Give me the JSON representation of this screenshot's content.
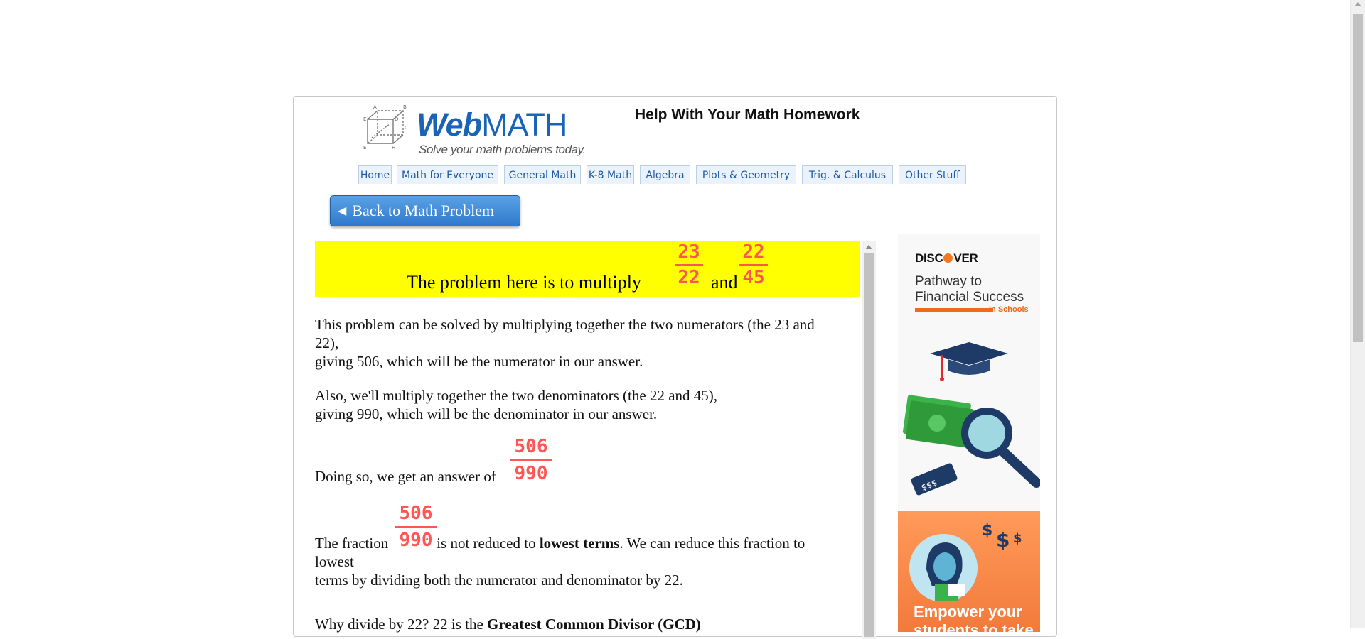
{
  "header": {
    "brand_web": "Web",
    "brand_math": "MATH",
    "tagline": "Solve your math problems today.",
    "title": "Help With Your Math Homework"
  },
  "nav": {
    "tabs": [
      {
        "label": "Home"
      },
      {
        "label": "Math for Everyone"
      },
      {
        "label": "General Math"
      },
      {
        "label": "K-8 Math"
      },
      {
        "label": "Algebra"
      },
      {
        "label": "Plots & Geometry"
      },
      {
        "label": "Trig. & Calculus"
      },
      {
        "label": "Other Stuff"
      }
    ]
  },
  "back_button": {
    "label": "Back to Math Problem"
  },
  "problem": {
    "intro": "The problem here is to multiply",
    "and": "and",
    "fraction1": {
      "numerator": "23",
      "denominator": "22"
    },
    "fraction2": {
      "numerator": "22",
      "denominator": "45"
    }
  },
  "explanation": {
    "p1_line1": "This problem can be solved by multiplying together the two numerators (the 23 and",
    "p1_line2": "22),",
    "p1_line3": "giving 506, which will be the numerator in our answer.",
    "p2_line1": "Also, we'll multiply together the two denominators (the 22 and 45),",
    "p2_line2": "giving 990, which will be the denominator in our answer.",
    "answer_prefix": "Doing so, we get an answer of",
    "answer_fraction": {
      "numerator": "506",
      "denominator": "990"
    },
    "p4_prefix": "The fraction",
    "p4_fraction": {
      "numerator": "506",
      "denominator": "990"
    },
    "p4_mid": "is not reduced to",
    "p4_bold": "lowest terms",
    "p4_rest": ". We can reduce this fraction to",
    "p4_line2": "lowest",
    "p4_line3": "terms by dividing both the numerator and denominator by 22.",
    "p5_prefix": "Why divide by 22? 22 is the",
    "p5_bold": "Greatest Common Divisor (GCD)"
  },
  "ad": {
    "brand_pre": "DISC",
    "brand_post": "VER",
    "headline_line1": "Pathway to",
    "headline_line2": "Financial Success",
    "subline": "In Schools",
    "cta_line1": "Empower your",
    "cta_line2": "students to take"
  },
  "colors": {
    "brand_blue": "#1a64b8",
    "tab_text": "#1f58a3",
    "problem_band": "#ffff00",
    "fraction_red": "#ff5555",
    "ad_orange": "#f27a3b"
  }
}
